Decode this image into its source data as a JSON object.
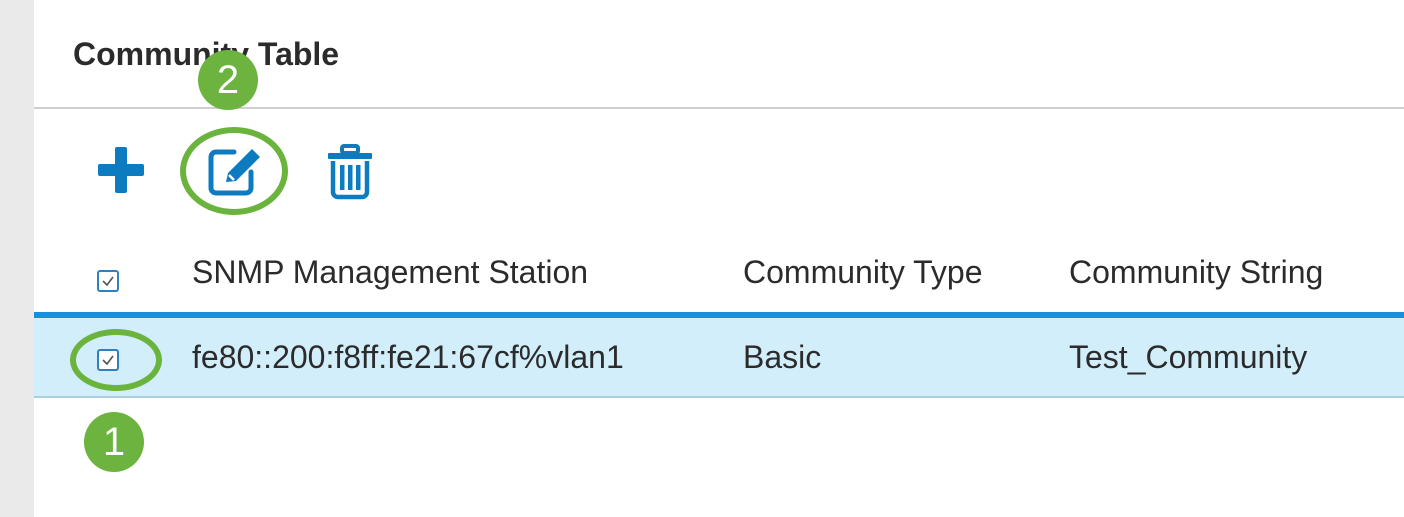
{
  "section": {
    "title": "Community Table"
  },
  "toolbar": {
    "add_icon": "plus-icon",
    "edit_icon": "edit-icon",
    "delete_icon": "trash-icon"
  },
  "callouts": [
    {
      "number": "2",
      "target": "edit-button"
    },
    {
      "number": "1",
      "target": "row-checkbox"
    }
  ],
  "table": {
    "columns": [
      "SNMP Management Station",
      "Community Type",
      "Community String"
    ],
    "rows": [
      {
        "checked": true,
        "station": "fe80::200:f8ff:fe21:67cf%vlan1",
        "type": "Basic",
        "string": "Test_Community"
      }
    ]
  },
  "colors": {
    "accent_blue": "#0d7bc0",
    "selected_row": "#d2eefa",
    "callout_green": "#6cb33f"
  }
}
